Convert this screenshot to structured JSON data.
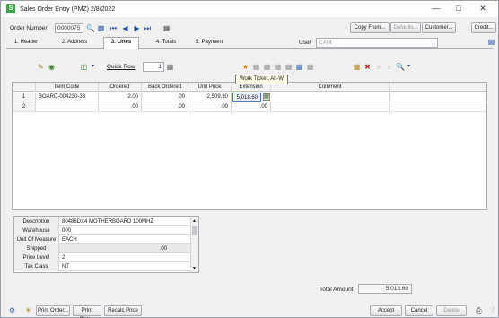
{
  "window": {
    "title": "Sales Order Entry (PMZ) 2/8/2022",
    "min": "—",
    "max": "□",
    "close": "✕"
  },
  "header": {
    "order_number_label": "Order Number",
    "order_number": "0000075",
    "user_label": "User",
    "user": "CAM",
    "copy_from": "Copy From...",
    "defaults": "Defaults...",
    "customer": "Customer...",
    "credit": "Credit..."
  },
  "tabs": [
    {
      "label": "1. Header"
    },
    {
      "label": "2. Address"
    },
    {
      "label": "3. Lines"
    },
    {
      "label": "4. Totals"
    },
    {
      "label": "5. Payment"
    }
  ],
  "toolbar": {
    "quick_row_label": "Quick Row",
    "quick_row_value": "1"
  },
  "tooltip": "Work Ticket, Alt-W",
  "grid": {
    "columns": [
      "Item Code",
      "Ordered",
      "Back Ordered",
      "Unit Price",
      "Extension",
      "Comment"
    ],
    "rows": [
      {
        "num": "1",
        "item": "BOARD-004230-33",
        "ordered": "2.00",
        "back": ".00",
        "price": "2,509.30",
        "ext": "5,018.60",
        "comment": ""
      },
      {
        "num": "2",
        "item": "",
        "ordered": ".00",
        "back": ".00",
        "price": ".00",
        "ext": ".00",
        "comment": ""
      }
    ]
  },
  "detail": [
    {
      "label": "Description",
      "value": "80486DX4 MOTHERBOARD 100MHZ"
    },
    {
      "label": "Warehouse",
      "value": "000"
    },
    {
      "label": "Unit Of Measure",
      "value": "EACH"
    },
    {
      "label": "Shipped",
      "value": ".00"
    },
    {
      "label": "Price Level",
      "value": "2"
    },
    {
      "label": "Tax Class",
      "value": "NT"
    }
  ],
  "totals": {
    "label": "Total Amount",
    "value": "5,018.60"
  },
  "footer": {
    "print_order": "Print Order...",
    "print_pick": "Print Pick...",
    "recalc_price": "Recalc Price",
    "accept": "Accept",
    "cancel": "Cancel",
    "delete": "Delete"
  }
}
